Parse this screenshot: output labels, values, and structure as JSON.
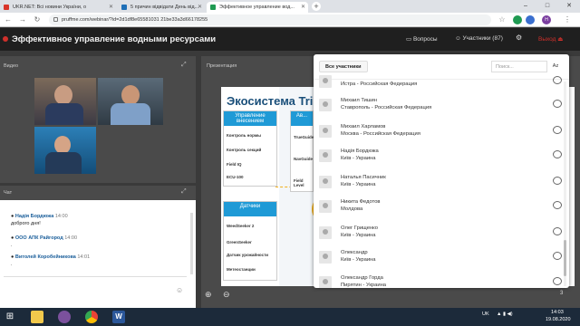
{
  "browser": {
    "tabs": [
      {
        "label": "UKR.NET: Всі новини України, о",
        "active": false,
        "favicon_color": "#d9352a"
      },
      {
        "label": "5 причин відвідати День від...",
        "active": false,
        "favicon_color": "#1f6fb7"
      },
      {
        "label": "Эффективное управление вод...",
        "active": true,
        "favicon_color": "#1f9a52"
      }
    ],
    "url": "pruffme.com/webinar/?id=2d1df8e65581031 21be33a3d66178255",
    "profile_initial": "H",
    "window_controls": [
      "–",
      "□",
      "✕"
    ]
  },
  "app": {
    "title": "Эффективное управление водными ресурсами",
    "questions_label": "Вопросы",
    "participants_label": "Участники (87)",
    "exit_label": "Выход",
    "accent": "#d0302b"
  },
  "video": {
    "label": "Видео"
  },
  "presentation": {
    "label": "Презентация",
    "slide_title": "Экосистема Tri",
    "page_number": "3",
    "cards": [
      {
        "title": "Управление внесением",
        "items": [
          "Контроль нормы",
          "Контроль секций",
          "Field IQ",
          "ECU-100"
        ]
      },
      {
        "title": "Датчики",
        "items": [
          "WeedSeeker 2",
          "GreenSeeker",
          "Датчик урожайности",
          "Метеостанции"
        ]
      },
      {
        "title": "Ав...",
        "items": [
          "TrueGuide",
          "NavGuide",
          "Field Level"
        ]
      }
    ]
  },
  "chat": {
    "label": "Чат",
    "messages": [
      {
        "author": "Надія Бордюжа",
        "time": "14:00",
        "text": "доброго дня!"
      },
      {
        "author": "ООО АПК Райгород",
        "time": "14:00",
        "text": "."
      },
      {
        "author": "Витолей Коробейникова",
        "time": "14:01",
        "text": "."
      }
    ]
  },
  "participants": {
    "tab_label": "Все участники",
    "search_placeholder": "Поиск...",
    "sort_label": "Az",
    "list": [
      {
        "name": "",
        "location": "Истра - Российская Федерация"
      },
      {
        "name": "Михаил Тишин",
        "location": "Ставрополь - Российская Федерация"
      },
      {
        "name": "Михаил Харламов",
        "location": "Москва - Российская Федерация"
      },
      {
        "name": "Надія Бордюжа",
        "location": "Київ - Украина"
      },
      {
        "name": "Наталья Пасичник",
        "location": "Київ - Украина"
      },
      {
        "name": "Никита Федотов",
        "location": "Молдова"
      },
      {
        "name": "Олег Грищенко",
        "location": "Київ - Украина"
      },
      {
        "name": "Олександр",
        "location": "Київ - Украина"
      },
      {
        "name": "Олександр Горда",
        "location": "Пирятин - Украина"
      }
    ]
  },
  "taskbar": {
    "language": "UK",
    "time": "14:03",
    "date": "19.08.2020"
  }
}
